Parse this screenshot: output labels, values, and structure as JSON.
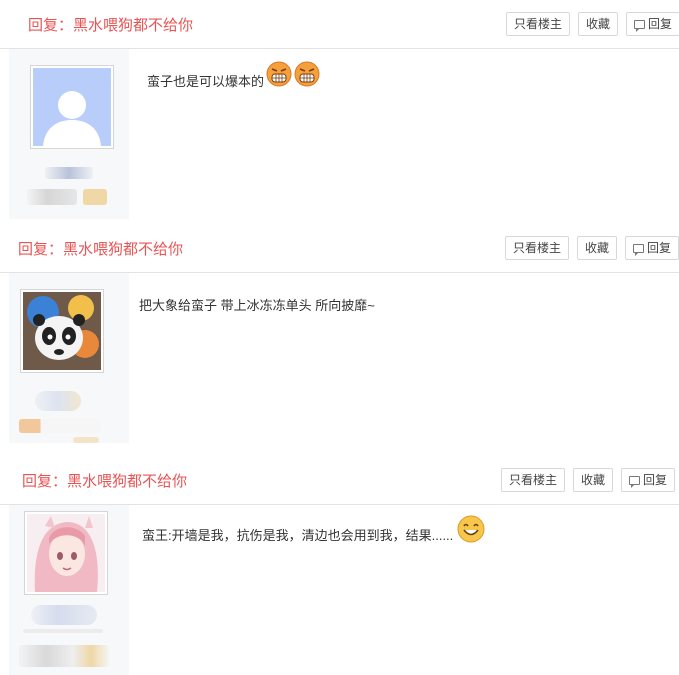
{
  "posts": [
    {
      "title": "回复：黑水喂狗都不给你",
      "buttons": {
        "only_op": "只看楼主",
        "favorite": "收藏",
        "reply": "回复"
      },
      "content": "蛮子也是可以爆本的",
      "emojis": [
        "angry-face-icon",
        "angry-face-icon"
      ]
    },
    {
      "title": "回复：黑水喂狗都不给你",
      "buttons": {
        "only_op": "只看楼主",
        "favorite": "收藏",
        "reply": "回复"
      },
      "content": "把大象给蛮子 带上冰冻冻单头 所向披靡~",
      "emojis": []
    },
    {
      "title": "回复：黑水喂狗都不给你",
      "buttons": {
        "only_op": "只看楼主",
        "favorite": "收藏",
        "reply": "回复"
      },
      "content": "蛮王:开墙是我，抗伤是我，清边也会用到我，结果......",
      "emojis": [
        "grin-face-icon"
      ]
    }
  ],
  "colors": {
    "title": "#e85454",
    "sidebar_bg": "#f7f8fa",
    "border": "#e3e3e3"
  }
}
